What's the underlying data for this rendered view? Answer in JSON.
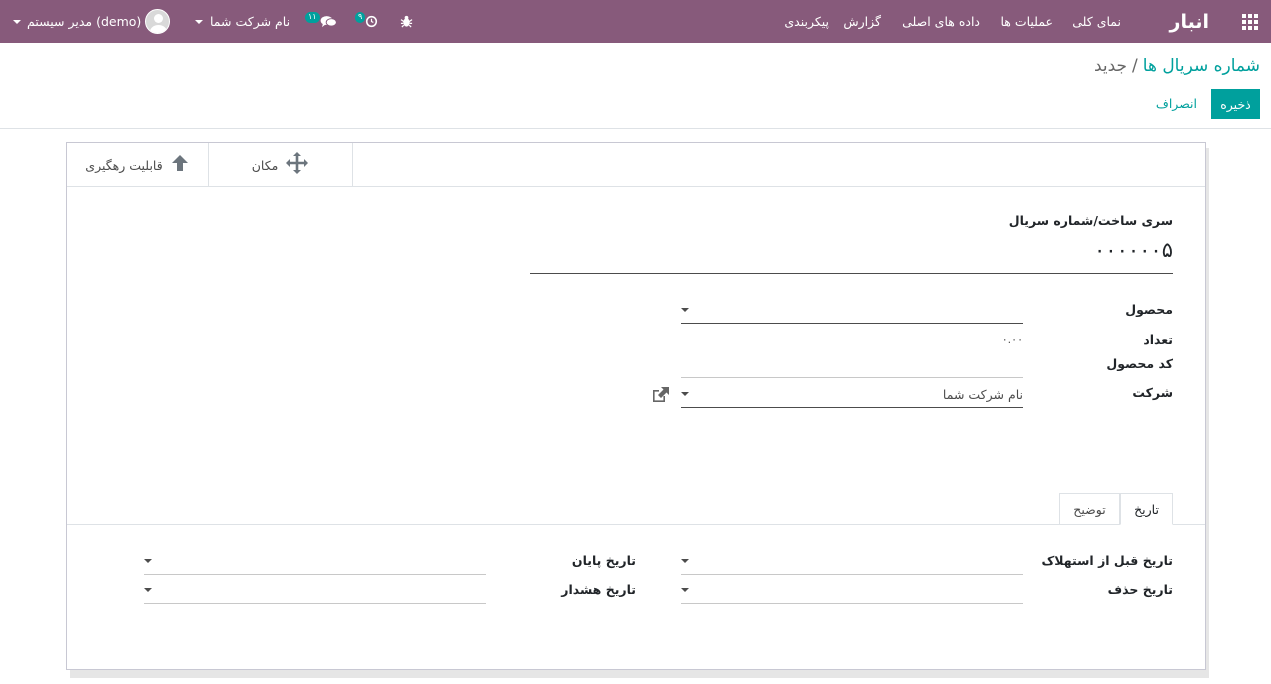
{
  "navbar": {
    "brand": "انبار",
    "menu": [
      "نمای کلی",
      "عملیات ها",
      "داده های اصلی",
      "گزارش",
      "پیکربندی"
    ],
    "activity_count": "۹",
    "messages_count": "۱۱",
    "company": "نام شرکت شما",
    "user": "مدیر سیستم (demo)"
  },
  "breadcrumb": {
    "parent": "شماره سریال ها",
    "separator": "/",
    "current": "جدید"
  },
  "buttons": {
    "save": "ذخیره",
    "discard": "انصراف"
  },
  "smart_buttons": {
    "traceability": "قابلیت رهگیری",
    "location": "مکان"
  },
  "form": {
    "name_label": "سری ساخت/شماره سریال",
    "name_value": "۰۰۰۰۰۰۵",
    "product_label": "محصول",
    "product_value": "",
    "quantity_label": "تعداد",
    "quantity_value": "۰.۰۰",
    "ref_label": "کد محصول",
    "ref_value": "",
    "company_label": "شرکت",
    "company_value": "نام شرکت شما"
  },
  "tabs": [
    "تاریخ",
    "توضیح"
  ],
  "dates": {
    "removal_label": "تاریخ قبل از استهلاک",
    "end_label": "تاریخ پایان",
    "delete_label": "تاریخ حذف",
    "alert_label": "تاریخ هشدار"
  },
  "colors": {
    "navbar": "#875a7b",
    "primary": "#00a09d"
  }
}
